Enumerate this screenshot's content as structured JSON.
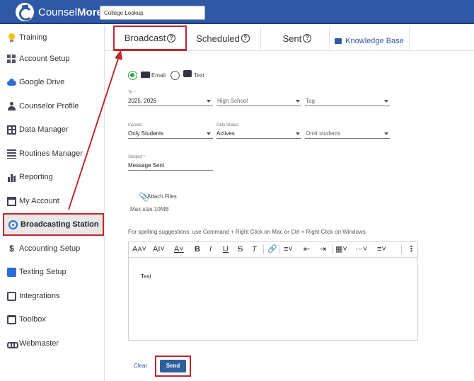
{
  "header": {
    "brand_part1": "Counsel",
    "brand_part2": "More",
    "search_value": "College Lookup"
  },
  "sidebar": {
    "items": [
      {
        "label": "Training",
        "icon": "lightbulb-icon"
      },
      {
        "label": "Account Setup",
        "icon": "building-icon"
      },
      {
        "label": "Google Drive",
        "icon": "google-drive-icon"
      },
      {
        "label": "Counselor Profile",
        "icon": "person-icon"
      },
      {
        "label": "Data Manager",
        "icon": "table-icon"
      },
      {
        "label": "Routines Manager",
        "icon": "list-icon"
      },
      {
        "label": "Reporting",
        "icon": "bar-chart-icon"
      },
      {
        "label": "My Account",
        "icon": "window-icon"
      },
      {
        "label": "Broadcasting Station",
        "icon": "broadcast-icon"
      },
      {
        "label": "Accounting Setup",
        "icon": "dollar-icon"
      },
      {
        "label": "Texting Setup",
        "icon": "chat-icon"
      },
      {
        "label": "Integrations",
        "icon": "puzzle-icon"
      },
      {
        "label": "Toolbox",
        "icon": "toolbox-icon"
      },
      {
        "label": "Webmaster",
        "icon": "link-icon"
      }
    ],
    "active_index": 8
  },
  "tabs": {
    "broadcast": "Broadcast",
    "scheduled": "Scheduled",
    "sent": "Sent",
    "knowledge_base": "Knowledge Base"
  },
  "form": {
    "mode_email": "Email",
    "mode_text": "Text",
    "to_label": "To *",
    "to_value": "2025, 2026",
    "high_school_placeholder": "High School",
    "tag_placeholder": "Tag",
    "include_label": "Include",
    "include_value": "Only Students",
    "only_status_label": "Only Status",
    "only_status_value": "Actives",
    "omit_placeholder": "Omit students",
    "subject_label": "Subject *",
    "subject_value": "Message Sent",
    "attach_label": "Attach Files",
    "max_size": "Max size 10MB",
    "spelling_hint": "For spelling suggestions: use Command + Right Click on Mac or Ctrl + Right Click on Windows.",
    "body_text": "Test"
  },
  "toolbar": {
    "font_size_glyph": "A",
    "font_style_glyph": "AI",
    "font_color_glyph": "A",
    "bold": "B",
    "italic": "I",
    "underline": "U",
    "strike": "S",
    "clear_format": "T",
    "more": "⋮"
  },
  "actions": {
    "clear": "Clear",
    "send": "Send"
  },
  "colors": {
    "header_bg": "#2f58a6",
    "highlight_red": "#c0272d",
    "send_bg": "#2f5f9c",
    "radio_green": "#2ea44f"
  }
}
